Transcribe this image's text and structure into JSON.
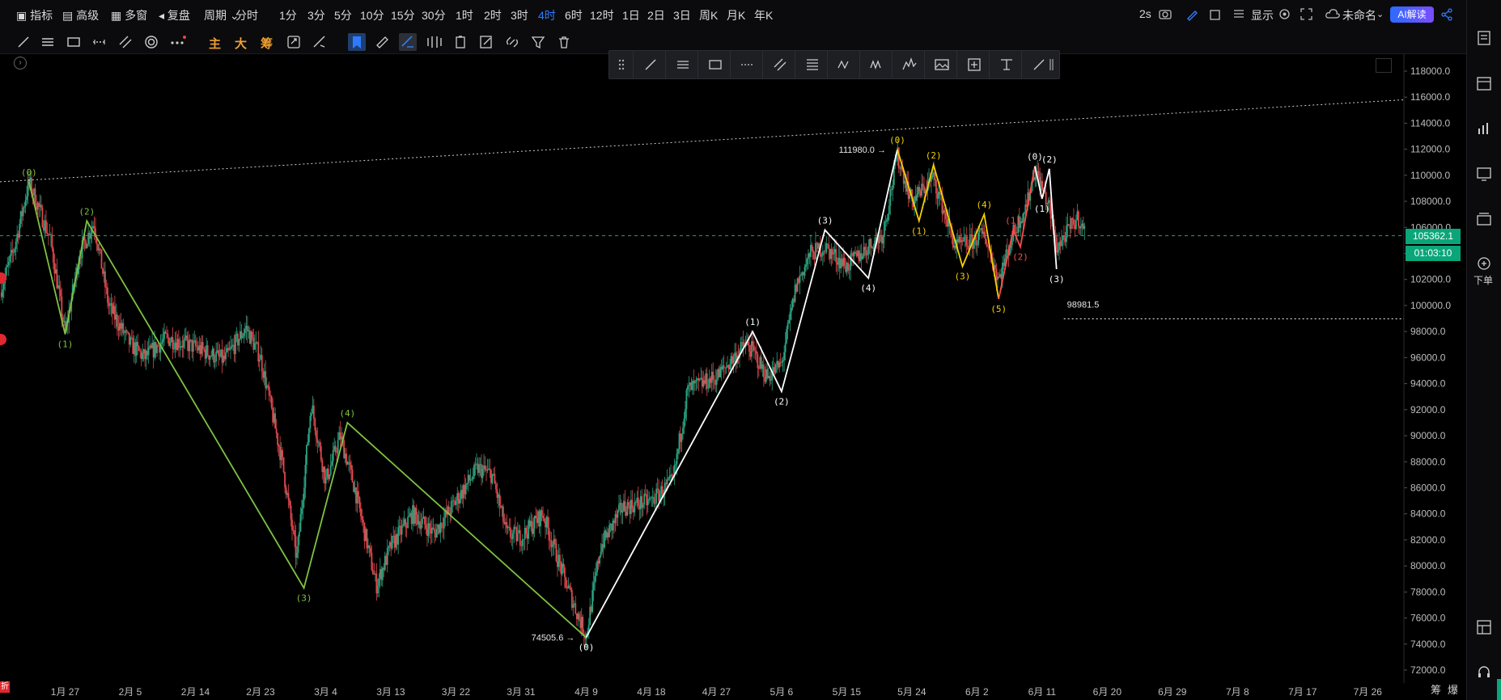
{
  "topbar": {
    "items": [
      "指标",
      "高级",
      "多窗",
      "复盘",
      "周期",
      "分时",
      "1分",
      "3分",
      "5分",
      "10分",
      "15分",
      "30分",
      "1时",
      "2时",
      "3时",
      "4时",
      "6时",
      "12时",
      "1日",
      "2日",
      "3日",
      "周K",
      "月K",
      "年K"
    ],
    "active": "4时",
    "right_items": {
      "refresh": "2s",
      "display": "显示",
      "unnamed": "未命名",
      "ai": "AI解读"
    }
  },
  "toolbar": {
    "text_tools": [
      "主",
      "大",
      "筹"
    ],
    "text_colors": [
      "#f0a030",
      "#f0a030",
      "#f0a030"
    ]
  },
  "right_rail": {
    "order_label": "下单"
  },
  "price_tags": {
    "last_price": "105362.1",
    "countdown": "01:03:10"
  },
  "bottom": {
    "left_badge": "折",
    "right_label": "筹",
    "right_label2": "爆"
  },
  "colors": {
    "up": "#2aa380",
    "down": "#e0474d",
    "wave_green": "#7ec242",
    "wave_white": "#ffffff",
    "wave_yellow": "#f5d000",
    "wave_red": "#ff4a4a",
    "accent": "#2f7bff",
    "price_tag": "#0aa67a"
  },
  "chart_data": {
    "type": "candlestick",
    "interval": "4时",
    "y_axis": {
      "min": 72000,
      "max": 118000,
      "ticks": [
        72000.0,
        74000.0,
        76000.0,
        78000.0,
        80000.0,
        82000.0,
        84000.0,
        86000.0,
        88000.0,
        90000.0,
        92000.0,
        94000.0,
        96000.0,
        98000.0,
        100000.0,
        102000.0,
        104000.0,
        106000.0,
        108000.0,
        110000.0,
        112000.0,
        114000.0,
        116000.0,
        118000.0
      ],
      "tick_labels": [
        "72000.0",
        "74000.0",
        "76000.0",
        "78000.0",
        "80000.0",
        "82000.0",
        "84000.0",
        "86000.0",
        "88000.0",
        "90000.0",
        "92000.0",
        "94000.0",
        "96000.0",
        "98000.0",
        "100000.0",
        "102000.0",
        "104000.0",
        "106000.0",
        "108000.0",
        "110000.0",
        "112000.0",
        "114000.0",
        "116000.0",
        "118000.0"
      ]
    },
    "x_axis": {
      "start": "2025-01-18",
      "end": "2025-07-31",
      "ticks": [
        {
          "date": "2025-01-27",
          "label": "1月 27"
        },
        {
          "date": "2025-02-05",
          "label": "2月 5"
        },
        {
          "date": "2025-02-14",
          "label": "2月 14"
        },
        {
          "date": "2025-02-23",
          "label": "2月 23"
        },
        {
          "date": "2025-03-04",
          "label": "3月 4"
        },
        {
          "date": "2025-03-13",
          "label": "3月 13"
        },
        {
          "date": "2025-03-22",
          "label": "3月 22"
        },
        {
          "date": "2025-03-31",
          "label": "3月 31"
        },
        {
          "date": "2025-04-09",
          "label": "4月 9"
        },
        {
          "date": "2025-04-18",
          "label": "4月 18"
        },
        {
          "date": "2025-04-27",
          "label": "4月 27"
        },
        {
          "date": "2025-05-06",
          "label": "5月 6"
        },
        {
          "date": "2025-05-15",
          "label": "5月 15"
        },
        {
          "date": "2025-05-24",
          "label": "5月 24"
        },
        {
          "date": "2025-06-02",
          "label": "6月 2"
        },
        {
          "date": "2025-06-11",
          "label": "6月 11"
        },
        {
          "date": "2025-06-20",
          "label": "6月 20"
        },
        {
          "date": "2025-06-29",
          "label": "6月 29"
        },
        {
          "date": "2025-07-08",
          "label": "7月 8"
        },
        {
          "date": "2025-07-17",
          "label": "7月 17"
        },
        {
          "date": "2025-07-26",
          "label": "7月 26"
        }
      ]
    },
    "last_price": 105362.1,
    "price_path": [
      [
        "2025-01-18",
        101000
      ],
      [
        "2025-01-20",
        104500
      ],
      [
        "2025-01-22",
        109500
      ],
      [
        "2025-01-25",
        105000
      ],
      [
        "2025-01-27",
        97800
      ],
      [
        "2025-01-29",
        104000
      ],
      [
        "2025-01-31",
        106400
      ],
      [
        "2025-02-02",
        100000
      ],
      [
        "2025-02-05",
        97000
      ],
      [
        "2025-02-07",
        96000
      ],
      [
        "2025-02-10",
        97500
      ],
      [
        "2025-02-14",
        96800
      ],
      [
        "2025-02-18",
        95800
      ],
      [
        "2025-02-21",
        98300
      ],
      [
        "2025-02-23",
        96000
      ],
      [
        "2025-02-26",
        88000
      ],
      [
        "2025-02-28",
        80500
      ],
      [
        "2025-03-02",
        92500
      ],
      [
        "2025-03-04",
        86500
      ],
      [
        "2025-03-06",
        90000
      ],
      [
        "2025-03-08",
        86000
      ],
      [
        "2025-03-11",
        78500
      ],
      [
        "2025-03-13",
        81500
      ],
      [
        "2025-03-16",
        84000
      ],
      [
        "2025-03-19",
        82500
      ],
      [
        "2025-03-22",
        85000
      ],
      [
        "2025-03-25",
        87500
      ],
      [
        "2025-03-27",
        87000
      ],
      [
        "2025-03-29",
        82500
      ],
      [
        "2025-03-31",
        82200
      ],
      [
        "2025-04-03",
        84000
      ],
      [
        "2025-04-06",
        79000
      ],
      [
        "2025-04-08",
        76000
      ],
      [
        "2025-04-09",
        74600
      ],
      [
        "2025-04-11",
        81500
      ],
      [
        "2025-04-14",
        84500
      ],
      [
        "2025-04-18",
        85000
      ],
      [
        "2025-04-21",
        86500
      ],
      [
        "2025-04-23",
        93500
      ],
      [
        "2025-04-27",
        94500
      ],
      [
        "2025-05-01",
        97000
      ],
      [
        "2025-05-02",
        96500
      ],
      [
        "2025-05-04",
        94500
      ],
      [
        "2025-05-06",
        95500
      ],
      [
        "2025-05-08",
        101500
      ],
      [
        "2025-05-10",
        104000
      ],
      [
        "2025-05-12",
        104500
      ],
      [
        "2025-05-15",
        103000
      ],
      [
        "2025-05-18",
        104500
      ],
      [
        "2025-05-20",
        105500
      ],
      [
        "2025-05-22",
        111500
      ],
      [
        "2025-05-24",
        108000
      ],
      [
        "2025-05-27",
        109800
      ],
      [
        "2025-05-30",
        104500
      ],
      [
        "2025-06-01",
        104800
      ],
      [
        "2025-06-03",
        105500
      ],
      [
        "2025-06-05",
        102000
      ],
      [
        "2025-06-07",
        105500
      ],
      [
        "2025-06-09",
        108000
      ],
      [
        "2025-06-10",
        110500
      ],
      [
        "2025-06-12",
        107500
      ],
      [
        "2025-06-13",
        104500
      ],
      [
        "2025-06-14",
        105200
      ],
      [
        "2025-06-16",
        106800
      ],
      [
        "2025-06-17",
        105362
      ]
    ],
    "horizontal_lines": [
      {
        "label": "98981.5",
        "price": 98981.5,
        "from": "2025-06-14",
        "to": "2025-07-31",
        "style": "dotted",
        "color": "#ffffff"
      },
      {
        "price": 105362.1,
        "style": "dashed",
        "color": "#1fa37c",
        "full_width": true
      }
    ],
    "trend_line": {
      "from": [
        "2025-01-18",
        109500
      ],
      "to": [
        "2025-07-31",
        115800
      ],
      "style": "dotted",
      "color": "#ffffff"
    },
    "waves": [
      {
        "color": "#7ec242",
        "points": [
          {
            "date": "2025-01-22",
            "price": 109500,
            "label": "(0)",
            "pos": "above"
          },
          {
            "date": "2025-01-27",
            "price": 97800,
            "label": "(1)",
            "pos": "below"
          },
          {
            "date": "2025-01-30",
            "price": 106500,
            "label": "(2)",
            "pos": "above"
          },
          {
            "date": "2025-03-01",
            "price": 78300,
            "label": "(3)",
            "pos": "below"
          },
          {
            "date": "2025-03-07",
            "price": 91000,
            "label": "(4)",
            "pos": "above"
          },
          {
            "date": "2025-04-09",
            "price": 74500,
            "label": "",
            "pos": "below"
          }
        ]
      },
      {
        "color": "#ffffff",
        "points": [
          {
            "date": "2025-04-09",
            "price": 74505.6,
            "label": "(0)",
            "pos": "below"
          },
          {
            "date": "2025-05-02",
            "price": 98000,
            "label": "(1)",
            "pos": "above"
          },
          {
            "date": "2025-05-06",
            "price": 93400,
            "label": "(2)",
            "pos": "below"
          },
          {
            "date": "2025-05-12",
            "price": 105800,
            "label": "(3)",
            "pos": "above"
          },
          {
            "date": "2025-05-18",
            "price": 102100,
            "label": "(4)",
            "pos": "below"
          },
          {
            "date": "2025-05-22",
            "price": 111980,
            "label": "",
            "pos": "above"
          }
        ]
      },
      {
        "color": "#f5d000",
        "points": [
          {
            "date": "2025-05-22",
            "price": 111980,
            "label": "(0)",
            "pos": "above"
          },
          {
            "date": "2025-05-25",
            "price": 106500,
            "label": "(1)",
            "pos": "below"
          },
          {
            "date": "2025-05-27",
            "price": 110800,
            "label": "(2)",
            "pos": "above"
          },
          {
            "date": "2025-05-31",
            "price": 103000,
            "label": "(3)",
            "pos": "below"
          },
          {
            "date": "2025-06-03",
            "price": 107000,
            "label": "(4)",
            "pos": "above"
          },
          {
            "date": "2025-06-05",
            "price": 100500,
            "label": "(5)",
            "pos": "below"
          }
        ]
      },
      {
        "color": "#ff4a4a",
        "points": [
          {
            "date": "2025-06-05",
            "price": 100500,
            "label": "",
            "pos": "below"
          },
          {
            "date": "2025-06-07",
            "price": 105800,
            "label": "(1)",
            "pos": "above"
          },
          {
            "date": "2025-06-08",
            "price": 104500,
            "label": "(2)",
            "pos": "below"
          },
          {
            "date": "2025-06-10",
            "price": 110700,
            "label": "",
            "pos": "above"
          }
        ]
      },
      {
        "color": "#ffffff",
        "points": [
          {
            "date": "2025-06-10",
            "price": 110700,
            "label": "(0)",
            "pos": "above"
          },
          {
            "date": "2025-06-11",
            "price": 108200,
            "label": "(1)",
            "pos": "below"
          },
          {
            "date": "2025-06-12",
            "price": 110500,
            "label": "(2)",
            "pos": "above"
          },
          {
            "date": "2025-06-13",
            "price": 102800,
            "label": "(3)",
            "pos": "below"
          }
        ]
      }
    ],
    "price_annotations": [
      {
        "label": "111980.0",
        "date": "2025-05-22",
        "price": 111980
      },
      {
        "label": "74505.6",
        "date": "2025-04-09",
        "price": 74505.6
      },
      {
        "label": "98981.5",
        "date": "2025-06-14",
        "price": 98981.5
      }
    ]
  }
}
